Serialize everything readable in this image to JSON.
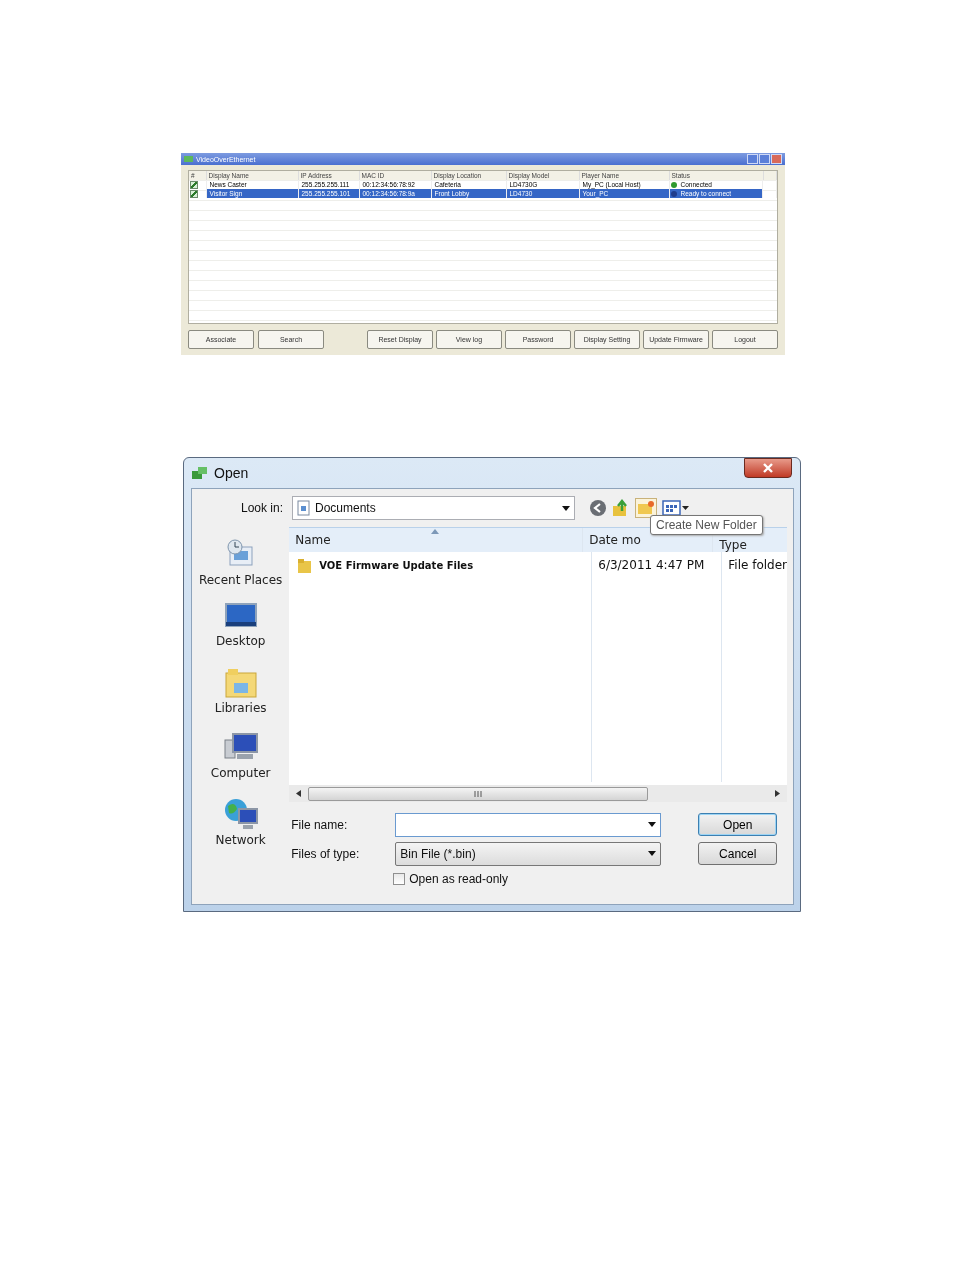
{
  "manager_window": {
    "title": "VideoOverEthernet",
    "table": {
      "check_header": "#",
      "columns": [
        "Display Name",
        "IP Address",
        "MAC ID",
        "Display Location",
        "Display Model",
        "Player Name",
        "Status"
      ],
      "rows": [
        {
          "checked": true,
          "selected": false,
          "color": "#2f9a2f",
          "cells": [
            "News Caster",
            "255.255.255.111",
            "00:12:34:56:78:92",
            "Cafeteria",
            "LD4730G",
            "My_PC (Local Host)",
            "Connected"
          ]
        },
        {
          "checked": true,
          "selected": true,
          "color": "#1f3c8c",
          "cells": [
            "Visitor Sign",
            "255.255.255.101",
            "00:12:34:56:78:9a",
            "Front Lobby",
            "LD4730",
            "Your_PC",
            "Ready to connect"
          ]
        }
      ]
    },
    "buttons_left": [
      "Associate",
      "Search"
    ],
    "buttons_right": [
      "Reset Display",
      "View log",
      "Password",
      "Display Setting",
      "Update Firmware",
      "Logout"
    ]
  },
  "open_dialog": {
    "title": "Open",
    "look_in": {
      "label": "Look in:",
      "value": "Documents"
    },
    "tooltip": "Create New Folder",
    "places": [
      {
        "label": "Recent Places",
        "kind": "recent"
      },
      {
        "label": "Desktop",
        "kind": "desktop"
      },
      {
        "label": "Libraries",
        "kind": "libraries"
      },
      {
        "label": "Computer",
        "kind": "computer"
      },
      {
        "label": "Network",
        "kind": "network"
      }
    ],
    "columns": [
      "Name",
      "Date mo",
      "Type"
    ],
    "files": [
      {
        "name": "VOE Firmware Update Files",
        "date": "6/3/2011 4:47 PM",
        "type": "File folder"
      }
    ],
    "file_name": {
      "label": "File name:"
    },
    "files_of_type": {
      "label": "Files of type:",
      "value": "Bin File (*.bin)"
    },
    "read_only": {
      "label": "Open as read-only",
      "checked": false
    },
    "buttons": [
      "Open",
      "Cancel"
    ]
  }
}
